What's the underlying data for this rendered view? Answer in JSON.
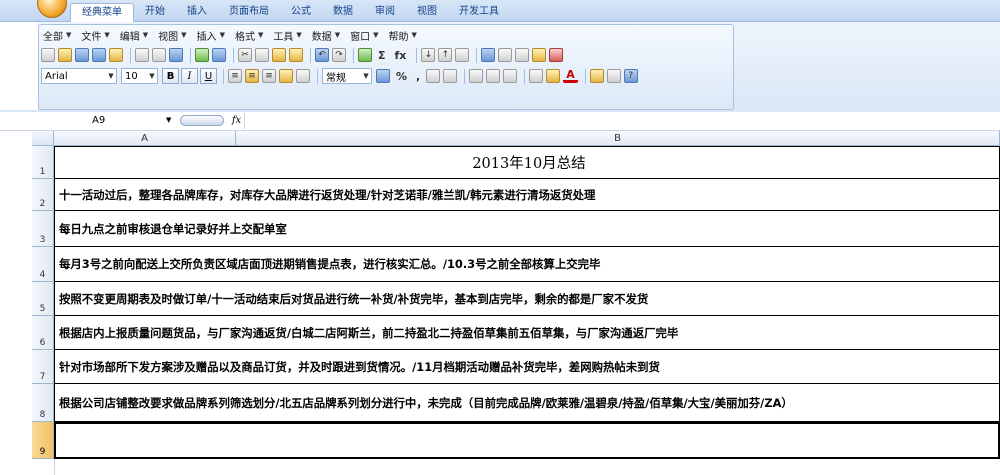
{
  "ribbon_tabs": [
    "经典菜单",
    "开始",
    "插入",
    "页面布局",
    "公式",
    "数据",
    "审阅",
    "视图",
    "开发工具"
  ],
  "menus": [
    "全部",
    "文件",
    "编辑",
    "视图",
    "插入",
    "格式",
    "工具",
    "数据",
    "窗口",
    "帮助"
  ],
  "font": {
    "name": "Arial",
    "size": "10"
  },
  "number_format": "常规",
  "format_buttons": {
    "bold": "B",
    "italic": "I",
    "underline": "U"
  },
  "misc_symbols": {
    "percent": "%",
    "comma": ",",
    "sigma": "Σ",
    "fx": "fx"
  },
  "name_box": "A9",
  "formula_label": "fx",
  "columns": [
    "A",
    "B"
  ],
  "rows": [
    {
      "num": "1",
      "text": "2013年10月总结"
    },
    {
      "num": "2",
      "text": "十一活动过后，整理各品牌库存，对库存大品牌进行返货处理/针对芝诺菲/雅兰凯/韩元素进行清场返货处理"
    },
    {
      "num": "3",
      "text": "每日九点之前审核退仓单记录好并上交配单室"
    },
    {
      "num": "4",
      "text": "每月3号之前向配送上交所负责区域店面顶进期销售提点表，进行核实汇总。/10.3号之前全部核算上交完毕"
    },
    {
      "num": "5",
      "text": "按照不变更周期表及时做订单/十一活动结束后对货品进行统一补货/补货完毕，基本到店完毕，剩余的都是厂家不发货"
    },
    {
      "num": "6",
      "text": "根据店内上报质量问题货品，与厂家沟通返货/白城二店阿斯兰，前二持盈北二持盈佰草集前五佰草集，与厂家沟通返厂完毕"
    },
    {
      "num": "7",
      "text": "针对市场部所下发方案涉及赠品以及商品订货，并及时跟进到货情况。/11月档期活动赠品补货完毕，差网购热帖未到货"
    },
    {
      "num": "8",
      "text": "根据公司店铺整改要求做品牌系列筛选划分/北五店品牌系列划分进行中，未完成（目前完成品牌/欧莱雅/温碧泉/持盈/佰草集/大宝/美丽加芬/ZA）"
    },
    {
      "num": "9",
      "text": ""
    }
  ]
}
